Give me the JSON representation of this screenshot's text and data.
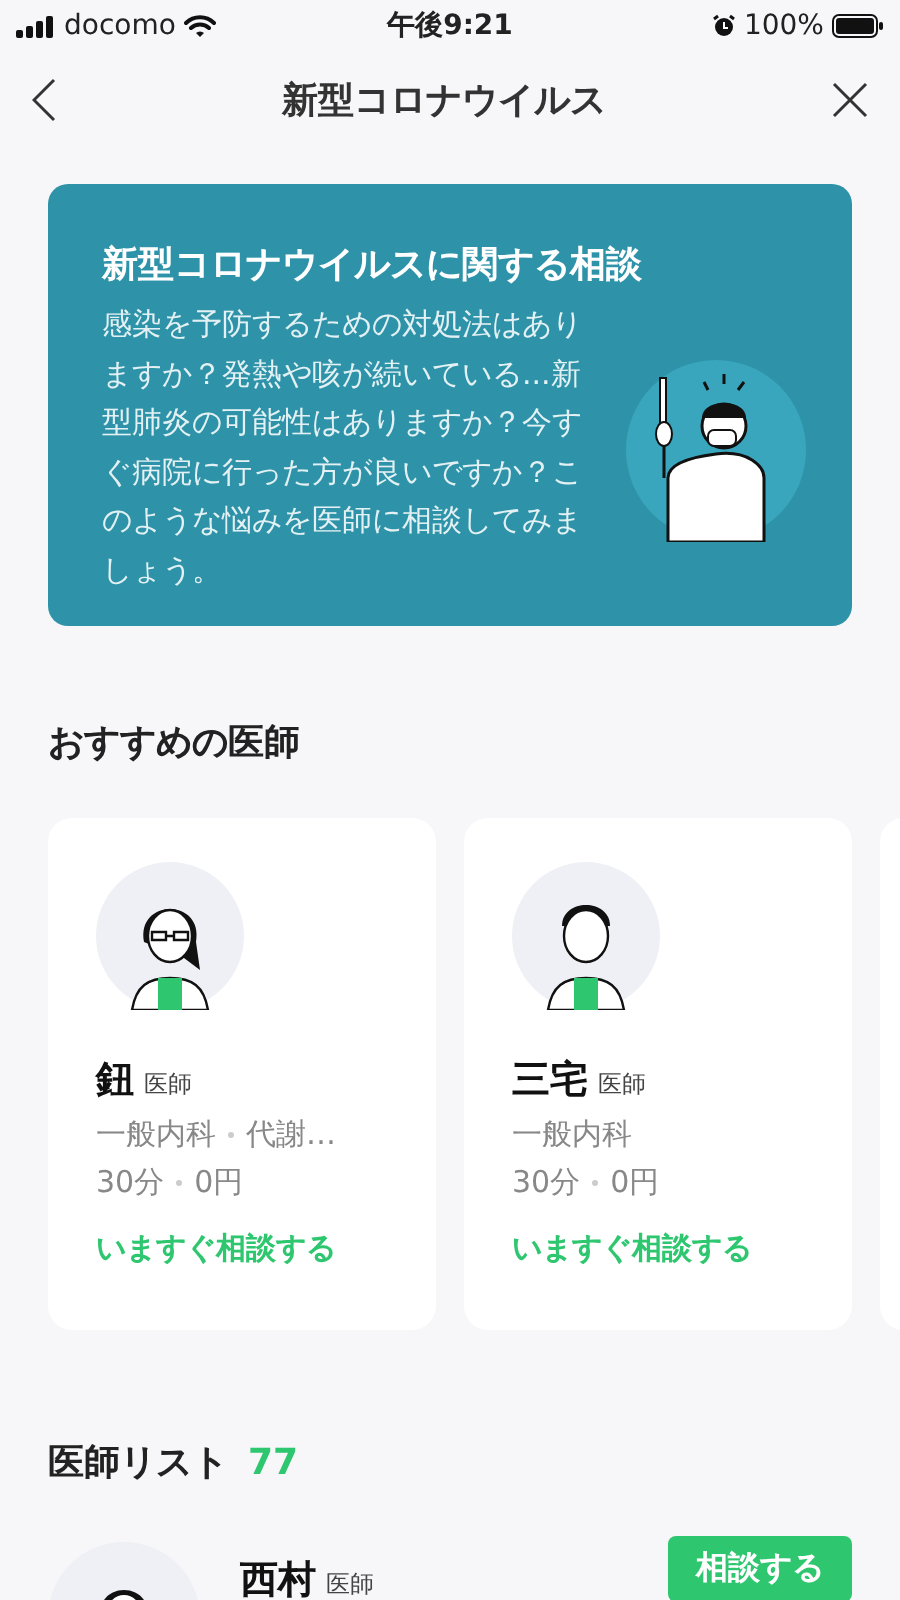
{
  "status_bar": {
    "carrier": "docomo",
    "time": "午後9:21",
    "battery": "100%"
  },
  "nav": {
    "title": "新型コロナウイルス"
  },
  "banner": {
    "title": "新型コロナウイルスに関する相談",
    "body": "感染を予防するための対処法はありますか？発熱や咳が続いている...新型肺炎の可能性はありますか？今すぐ病院に行った方が良いですか？このような悩みを医師に相談してみましょう。"
  },
  "recommended": {
    "title": "おすすめの医師",
    "doctors": [
      {
        "name": "鈕",
        "role": "医師",
        "kind": "glasses",
        "specialties": [
          "一般内科",
          "代謝…"
        ],
        "duration": "30分",
        "price": "0円",
        "action": "いますぐ相談する"
      },
      {
        "name": "三宅",
        "role": "医師",
        "kind": "plain",
        "specialties": [
          "一般内科"
        ],
        "duration": "30分",
        "price": "0円",
        "action": "いますぐ相談する"
      }
    ]
  },
  "doctor_list": {
    "title": "医師リスト",
    "count": "77",
    "rows": [
      {
        "name": "西村",
        "role": "医師",
        "button": "相談する"
      }
    ]
  }
}
